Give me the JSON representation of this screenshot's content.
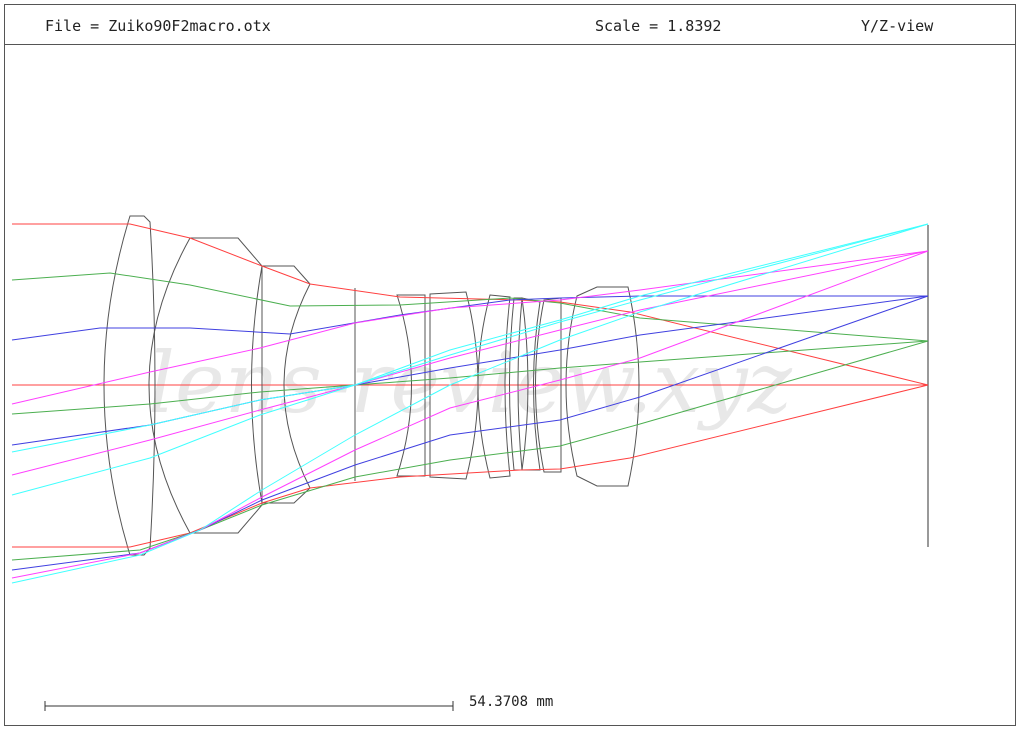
{
  "header": {
    "file": "File = Zuiko90F2macro.otx",
    "scale": "Scale = 1.8392",
    "view": "Y/Z-view"
  },
  "scalebar": {
    "label": "54.3708 mm"
  },
  "watermark": "lens-review.xyz",
  "colors": {
    "frame": "#555555",
    "lens": "#555555",
    "red": "#ff4040",
    "green": "#4caf50",
    "blue": "#4040e0",
    "magenta": "#ff40ff",
    "cyan": "#40ffff"
  }
}
